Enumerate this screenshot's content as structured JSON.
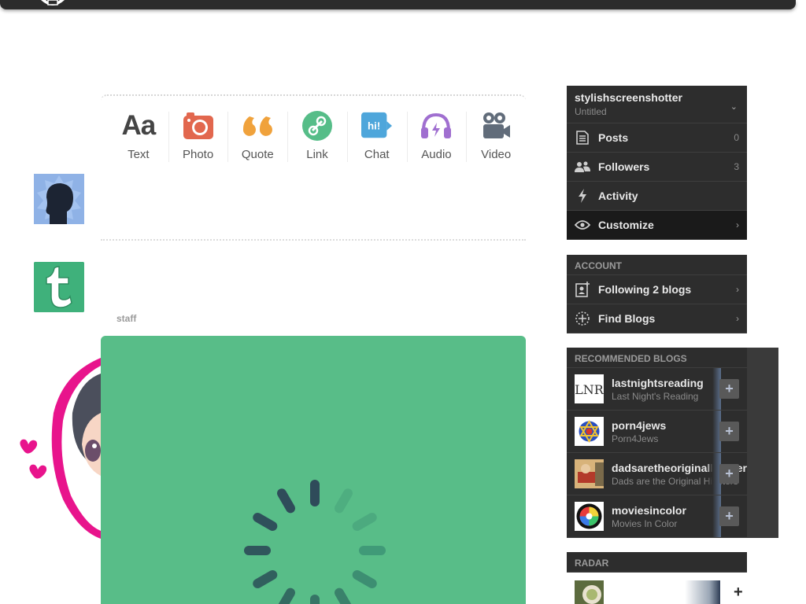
{
  "post_types": [
    {
      "label": "Text",
      "icon": "text-icon",
      "glyph": "Aa"
    },
    {
      "label": "Photo",
      "icon": "camera-icon"
    },
    {
      "label": "Quote",
      "icon": "quote-icon"
    },
    {
      "label": "Link",
      "icon": "link-icon"
    },
    {
      "label": "Chat",
      "icon": "chat-icon",
      "glyph": "hi!"
    },
    {
      "label": "Audio",
      "icon": "headphones-icon"
    },
    {
      "label": "Video",
      "icon": "video-camera-icon"
    }
  ],
  "feed": {
    "post_author": "staff",
    "card_color": "#58bd88"
  },
  "sidebar": {
    "blog": {
      "name": "stylishscreenshotter",
      "subtitle": "Untitled",
      "items": [
        {
          "label": "Posts",
          "count": "0"
        },
        {
          "label": "Followers",
          "count": "3"
        },
        {
          "label": "Activity"
        },
        {
          "label": "Customize"
        }
      ]
    },
    "account": {
      "heading": "ACCOUNT",
      "items": [
        {
          "label": "Following 2 blogs"
        },
        {
          "label": "Find Blogs"
        }
      ]
    },
    "recommended": {
      "heading": "RECOMMENDED BLOGS",
      "items": [
        {
          "name": "lastnightsreading",
          "title": "Last Night's Reading",
          "thumb": "LNR"
        },
        {
          "name": "porn4jews",
          "title": "Porn4Jews"
        },
        {
          "name": "dadsaretheoriginalhipsters",
          "title": "Dads are the Original Hipsters"
        },
        {
          "name": "moviesincolor",
          "title": "Movies In Color"
        }
      ]
    },
    "radar": {
      "heading": "RADAR"
    }
  },
  "colors": {
    "photo": "#e2674e",
    "quote": "#f0a23c",
    "link": "#56bd88",
    "chat": "#4ea6db",
    "audio": "#a06fd0",
    "video": "#616c7a"
  }
}
